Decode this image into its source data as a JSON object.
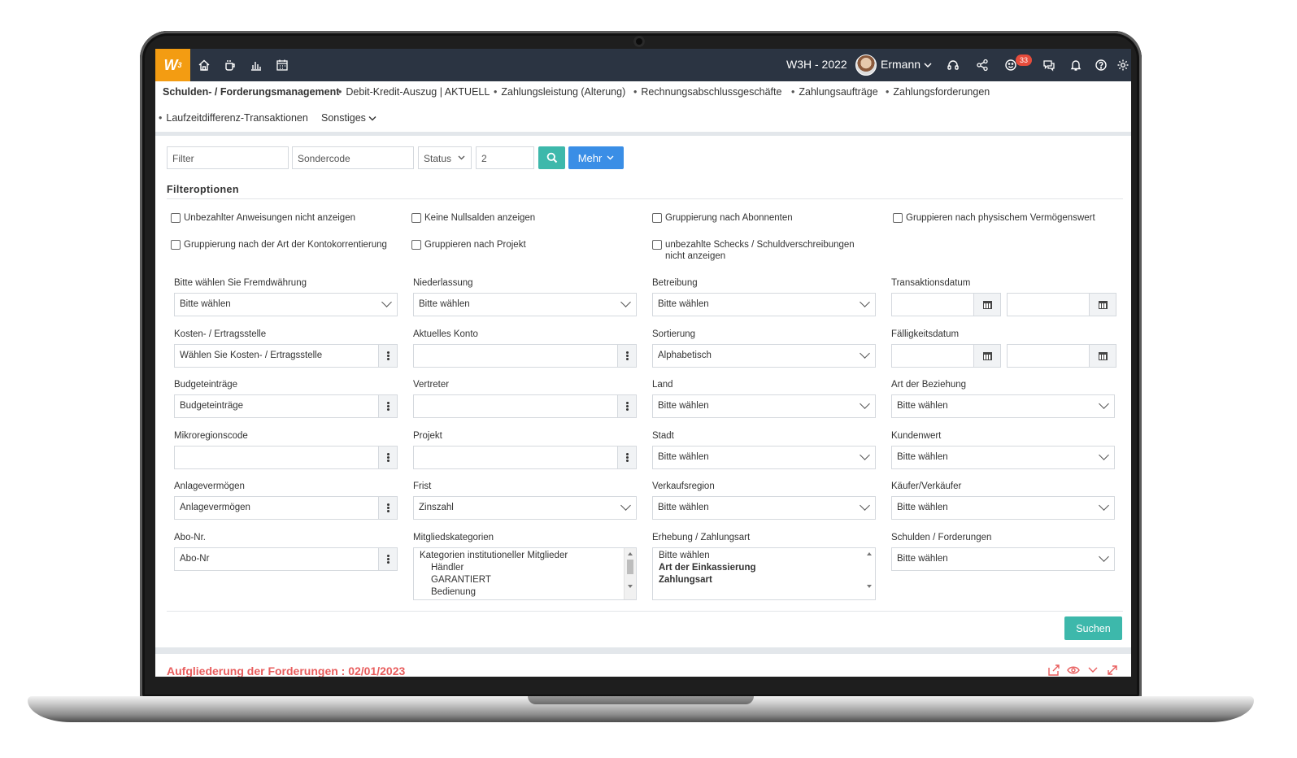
{
  "topbar": {
    "logo_text": "W",
    "logo_sup": "3",
    "nav_icons": [
      "home-icon",
      "coffee-icon",
      "bar-chart-icon",
      "calendar-icon"
    ],
    "company": "W3H - 2022",
    "user": "Ermann",
    "notification_count": "33",
    "right_icons": [
      "headset-icon",
      "share-icon",
      "smiley-icon",
      "chat-icon",
      "bell-icon",
      "help-icon",
      "settings-icon"
    ]
  },
  "breadcrumb": {
    "main": "Schulden- / Forderungsmanagement",
    "items": [
      "Debit-Kredit-Auszug | AKTUELL",
      "Zahlungsleistung (Alterung)",
      "Rechnungsabschlussgeschäfte",
      "Zahlungsaufträge",
      "Zahlungsforderungen",
      "Laufzeitdifferenz-Transaktionen"
    ],
    "more": "Sonstiges"
  },
  "filterbar": {
    "filter_placeholder": "Filter",
    "sondercode_placeholder": "Sondercode",
    "status_label": "Status",
    "count_value": "2",
    "mehr_label": "Mehr"
  },
  "filteroptions": {
    "title": "Filteroptionen",
    "checkboxes": [
      "Unbezahlter Anweisungen nicht anzeigen",
      "Keine Nullsalden anzeigen",
      "Gruppierung nach Abonnenten",
      "Gruppieren nach physischem Vermögenswert",
      "Gruppierung nach der Art der Kontokorrentierung",
      "Gruppieren nach Projekt",
      "unbezahlte Schecks / Schuldverschreibungen nicht anzeigen"
    ]
  },
  "fields": {
    "fremdwaehrung": {
      "label": "Bitte wählen Sie Fremdwährung",
      "value": "Bitte wählen"
    },
    "niederlassung": {
      "label": "Niederlassung",
      "value": "Bitte wählen"
    },
    "betreibung": {
      "label": "Betreibung",
      "value": "Bitte wählen"
    },
    "transaktionsdatum": {
      "label": "Transaktionsdatum"
    },
    "kostenstelle": {
      "label": "Kosten- / Ertragsstelle",
      "value": "Wählen Sie Kosten- / Ertragsstelle"
    },
    "aktuelles_konto": {
      "label": "Aktuelles Konto",
      "value": ""
    },
    "sortierung": {
      "label": "Sortierung",
      "value": "Alphabetisch"
    },
    "faelligkeitsdatum": {
      "label": "Fälligkeitsdatum"
    },
    "budgeteintraege": {
      "label": "Budgeteinträge",
      "value": "Budgeteinträge"
    },
    "vertreter": {
      "label": "Vertreter",
      "value": ""
    },
    "land": {
      "label": "Land",
      "value": "Bitte wählen"
    },
    "art_beziehung": {
      "label": "Art der Beziehung",
      "value": "Bitte wählen"
    },
    "mikroregion": {
      "label": "Mikroregionscode",
      "value": ""
    },
    "projekt": {
      "label": "Projekt",
      "value": ""
    },
    "stadt": {
      "label": "Stadt",
      "value": "Bitte wählen"
    },
    "kundenwert": {
      "label": "Kundenwert",
      "value": "Bitte wählen"
    },
    "anlagevermoegen": {
      "label": "Anlagevermögen",
      "value": "Anlagevermögen"
    },
    "frist": {
      "label": "Frist",
      "value": "Zinszahl"
    },
    "verkaufsregion": {
      "label": "Verkaufsregion",
      "value": "Bitte wählen"
    },
    "kaeufer": {
      "label": "Käufer/Verkäufer",
      "value": "Bitte wählen"
    },
    "abo": {
      "label": "Abo-Nr.",
      "value": "Abo-Nr"
    },
    "mitglied": {
      "label": "Mitgliedskategorien",
      "options": [
        "Kategorien institutioneller Mitglieder",
        "Händler",
        "GARANTIERT",
        "Bedienung"
      ]
    },
    "erhebung": {
      "label": "Erhebung / Zahlungsart",
      "options": [
        "Bitte wählen",
        "Art der Einkassierung",
        "Zahlungsart"
      ]
    },
    "schulden": {
      "label": "Schulden / Forderungen",
      "value": "Bitte wählen"
    }
  },
  "actions": {
    "suchen": "Suchen"
  },
  "section2": {
    "title": "Aufgliederung der Forderungen : 02/01/2023"
  },
  "colors": {
    "accent_teal": "#3db8ab",
    "accent_blue": "#3a8ee6",
    "logo_orange": "#f39c12",
    "topbar": "#2b3442",
    "section_red": "#e85d5d"
  }
}
